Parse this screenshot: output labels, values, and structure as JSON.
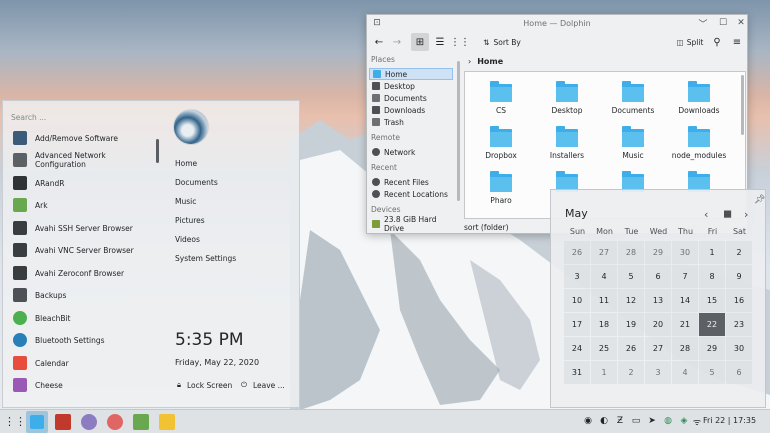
{
  "dolphin": {
    "title": "Home — Dolphin",
    "toolbar": {
      "sort_label": "Sort By",
      "split_label": "Split"
    },
    "places": {
      "header": "Places",
      "items": [
        "Home",
        "Desktop",
        "Documents",
        "Downloads",
        "Trash"
      ],
      "remote_header": "Remote",
      "remote_items": [
        "Network"
      ],
      "recent_header": "Recent",
      "recent_items": [
        "Recent Files",
        "Recent Locations"
      ],
      "devices_header": "Devices",
      "devices_items": [
        "23.8 GiB Hard Drive"
      ]
    },
    "breadcrumb": "Home",
    "folders": [
      "CS",
      "Desktop",
      "Documents",
      "Downloads",
      "Dropbox",
      "Installers",
      "Music",
      "node_modules",
      "Pharo"
    ],
    "status": "sort (folder)"
  },
  "launcher": {
    "search_placeholder": "Search ...",
    "apps": [
      "Add/Remove Software",
      "Advanced Network Configuration",
      "ARandR",
      "Ark",
      "Avahi SSH Server Browser",
      "Avahi VNC Server Browser",
      "Avahi Zeroconf Browser",
      "Backups",
      "BleachBit",
      "Bluetooth Settings",
      "Calendar",
      "Cheese"
    ],
    "favorites": [
      "Home",
      "Documents",
      "Music",
      "Pictures",
      "Videos",
      "System Settings"
    ],
    "time": "5:35 PM",
    "date": "Friday, May 22, 2020",
    "lock_label": "Lock Screen",
    "leave_label": "Leave ..."
  },
  "calendar": {
    "month": "May",
    "weekdays": [
      "Sun",
      "Mon",
      "Tue",
      "Wed",
      "Thu",
      "Fri",
      "Sat"
    ],
    "weeks": [
      [
        "26",
        "27",
        "28",
        "29",
        "30",
        "1",
        "2"
      ],
      [
        "3",
        "4",
        "5",
        "6",
        "7",
        "8",
        "9"
      ],
      [
        "10",
        "11",
        "12",
        "13",
        "14",
        "15",
        "16"
      ],
      [
        "17",
        "18",
        "19",
        "20",
        "21",
        "22",
        "23"
      ],
      [
        "24",
        "25",
        "26",
        "27",
        "28",
        "29",
        "30"
      ],
      [
        "31",
        "1",
        "2",
        "3",
        "4",
        "5",
        "6"
      ]
    ],
    "today": "22"
  },
  "taskbar": {
    "clock": "Fri 22 | 17:35"
  },
  "colors": {
    "accent": "#3daee9",
    "selection": "#cfe2f5",
    "today_bg": "#5c6166"
  }
}
